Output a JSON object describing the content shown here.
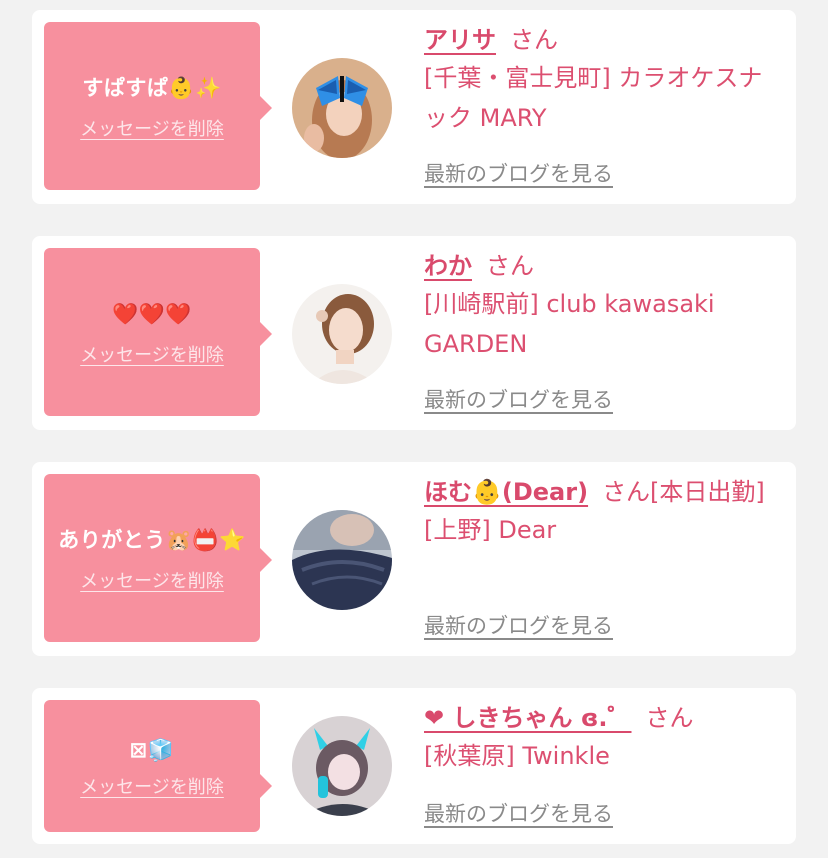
{
  "delete_label": "メッセージを削除",
  "blog_label": "最新のブログを見る",
  "accent_color": "#d94a6c",
  "bubble_color": "#f7909e",
  "cards": [
    {
      "message": "すぱすぱ👶✨",
      "name": "アリサ",
      "honorific": "さん",
      "shop": "[千葉・富士見町] カラオケスナック MARY"
    },
    {
      "message": "❤️❤️❤️",
      "name": "わか",
      "honorific": "さん",
      "shop": "[川崎駅前] club kawasaki GARDEN"
    },
    {
      "message": "ありがとう🐹📛⭐",
      "name": "ほむ👶(Dear)",
      "honorific": "さん[本日出勤]",
      "shop": "[上野] Dear"
    },
    {
      "message": "⊠🧊",
      "name": "❤ しきちゃん ɞ.゜",
      "honorific": "さん",
      "shop": "[秋葉原] Twinkle"
    }
  ]
}
